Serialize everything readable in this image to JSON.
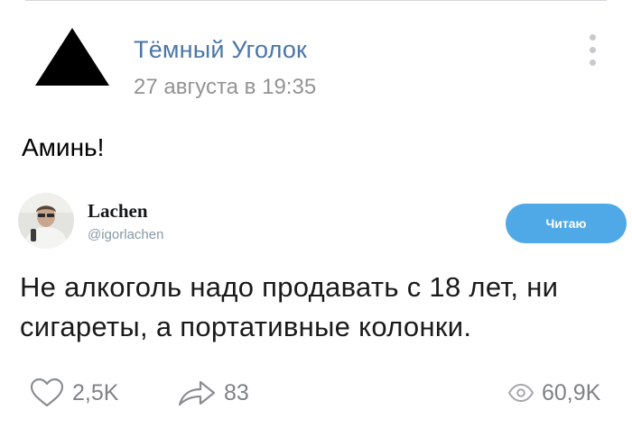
{
  "group": {
    "name": "Тёмный Уголок",
    "date": "27 августа в 19:35",
    "avatar_icon": "triangle-logo-icon"
  },
  "menu": {
    "icon": "more-vertical-icon"
  },
  "post": {
    "text": "Аминь!"
  },
  "tweet": {
    "author_name": "Lachen",
    "handle": "@igorlachen",
    "follow_label": "Читаю",
    "text": "Не алкоголь надо продавать с 18 лет, ни сигареты, а портативные колонки."
  },
  "stats": {
    "likes": "2,5K",
    "shares": "83",
    "views": "60,9K",
    "like_icon": "heart-icon",
    "share_icon": "share-arrow-icon",
    "views_icon": "eye-icon"
  },
  "colors": {
    "link_blue": "#4a76a8",
    "date_gray": "#939393",
    "follow_button": "#4fa9e7",
    "stat_gray": "#7f8286"
  }
}
